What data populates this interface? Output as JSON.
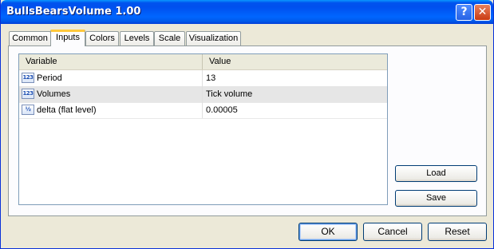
{
  "window": {
    "title": "BullsBearsVolume 1.00"
  },
  "titlebar_buttons": {
    "help": "?",
    "close": "✕"
  },
  "tabs": [
    {
      "label": "Common",
      "active": false
    },
    {
      "label": "Inputs",
      "active": true
    },
    {
      "label": "Colors",
      "active": false
    },
    {
      "label": "Levels",
      "active": false
    },
    {
      "label": "Scale",
      "active": false
    },
    {
      "label": "Visualization",
      "active": false
    }
  ],
  "grid": {
    "columns": [
      "Variable",
      "Value"
    ],
    "rows": [
      {
        "icon": "123",
        "variable": "Period",
        "value": "13"
      },
      {
        "icon": "123",
        "variable": "Volumes",
        "value": "Tick volume"
      },
      {
        "icon": "½",
        "variable": "delta (flat level)",
        "value": "0.00005"
      }
    ]
  },
  "side_buttons": {
    "load": "Load",
    "save": "Save"
  },
  "footer_buttons": {
    "ok": "OK",
    "cancel": "Cancel",
    "reset": "Reset"
  }
}
